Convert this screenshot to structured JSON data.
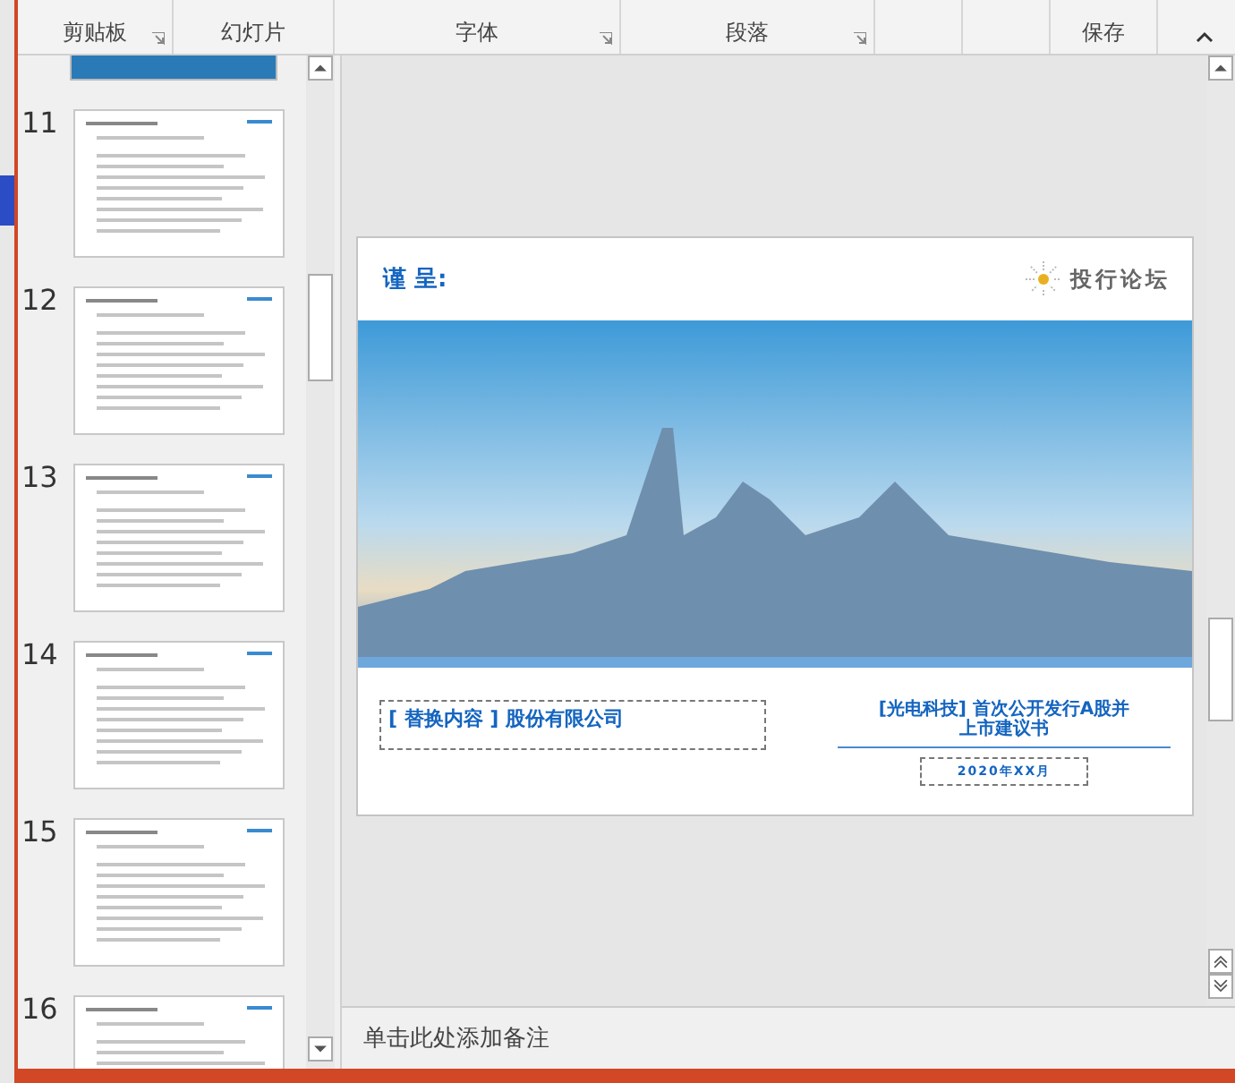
{
  "ribbon": {
    "groups": [
      {
        "label": "剪贴板",
        "launcher": true
      },
      {
        "label": "幻灯片",
        "launcher": false
      },
      {
        "label": "字体",
        "launcher": true
      },
      {
        "label": "段落",
        "launcher": true
      },
      {
        "label": "保存",
        "launcher": false
      }
    ]
  },
  "thumbnails": [
    {
      "number": "11"
    },
    {
      "number": "12"
    },
    {
      "number": "13"
    },
    {
      "number": "14"
    },
    {
      "number": "15"
    },
    {
      "number": "16"
    }
  ],
  "slide": {
    "greeting": "谨 呈:",
    "logo_text": "投行论坛",
    "company": "[ 替换内容 ] 股份有限公司",
    "title": "[光电科技] 首次公开发行A股并上市建议书",
    "date": "2020年XX月"
  },
  "notes": {
    "placeholder": "单击此处添加备注"
  }
}
